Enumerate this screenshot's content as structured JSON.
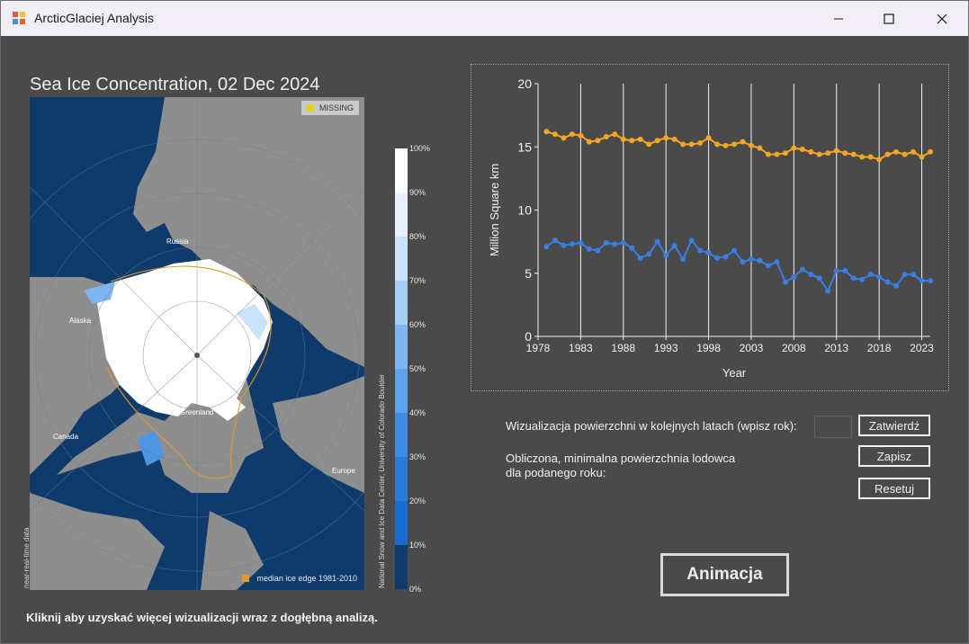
{
  "window": {
    "title": "ArcticGlaciej Analysis",
    "buttons": [
      "minimize",
      "maximize",
      "close"
    ]
  },
  "map": {
    "title": "Sea Ice Concentration, 02 Dec 2024",
    "missing_label": "MISSING",
    "median_label": "median ice edge 1981-2010",
    "left_caption": "near-real-time data",
    "right_caption": "National Snow and Ice Data Center, University of Colorado Boulder",
    "regions": {
      "russia": "Russia",
      "alaska": "Alaska",
      "greenland": "Greenland",
      "canada": "Canada",
      "europe": "Europe"
    },
    "colorbar_ticks": [
      "100%",
      "90%",
      "80%",
      "70%",
      "60%",
      "50%",
      "40%",
      "30%",
      "20%",
      "10%",
      "0%"
    ],
    "colors": {
      "ocean": "#0e3a6c",
      "land": "#8e8e8e",
      "ice": "#ffffff",
      "missing": "#e4d21b",
      "median_edge": "#e39a2b"
    }
  },
  "note": "Kliknij aby uzyskać więcej wizualizacji wraz z dogłębną analizą.",
  "controls": {
    "visualize_label": "Wizualizacja powierzchni w kolejnych latach (wpisz rok):",
    "year_input_value": "",
    "submit_button": "Zatwierdź",
    "computed_label_line1": "Obliczona, minimalna powierzchnia lodowca",
    "computed_label_line2": "dla podanego roku:",
    "save_button": "Zapisz",
    "reset_button": "Resetuj",
    "animate_button": "Animacja"
  },
  "chart_data": {
    "type": "line",
    "xlabel": "Year",
    "ylabel": "Million Square km",
    "xlim": [
      1978,
      2024
    ],
    "ylim": [
      0,
      20
    ],
    "x_ticks": [
      1978,
      1983,
      1988,
      1993,
      1998,
      2003,
      2008,
      2013,
      2018,
      2023
    ],
    "y_ticks": [
      0,
      5,
      10,
      15,
      20
    ],
    "grid": "vertical",
    "x": [
      1979,
      1980,
      1981,
      1982,
      1983,
      1984,
      1985,
      1986,
      1987,
      1988,
      1989,
      1990,
      1991,
      1992,
      1993,
      1994,
      1995,
      1996,
      1997,
      1998,
      1999,
      2000,
      2001,
      2002,
      2003,
      2004,
      2005,
      2006,
      2007,
      2008,
      2009,
      2010,
      2011,
      2012,
      2013,
      2014,
      2015,
      2016,
      2017,
      2018,
      2019,
      2020,
      2021,
      2022,
      2023,
      2024
    ],
    "series": [
      {
        "color": "#f5a623",
        "values": [
          16.2,
          16.0,
          15.7,
          16.0,
          15.9,
          15.4,
          15.5,
          15.8,
          16.0,
          15.6,
          15.5,
          15.6,
          15.2,
          15.5,
          15.7,
          15.6,
          15.2,
          15.2,
          15.3,
          15.7,
          15.2,
          15.1,
          15.2,
          15.4,
          15.1,
          14.9,
          14.4,
          14.4,
          14.5,
          14.9,
          14.8,
          14.6,
          14.4,
          14.5,
          14.7,
          14.5,
          14.4,
          14.2,
          14.2,
          14.0,
          14.4,
          14.6,
          14.4,
          14.6,
          14.2,
          14.6
        ]
      },
      {
        "color": "#3a7fe0",
        "values": [
          7.1,
          7.6,
          7.2,
          7.3,
          7.4,
          6.9,
          6.8,
          7.4,
          7.3,
          7.4,
          7.0,
          6.2,
          6.5,
          7.5,
          6.4,
          7.2,
          6.1,
          7.6,
          6.8,
          6.6,
          6.2,
          6.3,
          6.8,
          5.9,
          6.1,
          6.0,
          5.6,
          5.9,
          4.3,
          4.7,
          5.3,
          4.9,
          4.6,
          3.6,
          5.2,
          5.2,
          4.6,
          4.5,
          4.9,
          4.7,
          4.3,
          4.0,
          4.9,
          4.9,
          4.4,
          4.4
        ]
      }
    ]
  }
}
